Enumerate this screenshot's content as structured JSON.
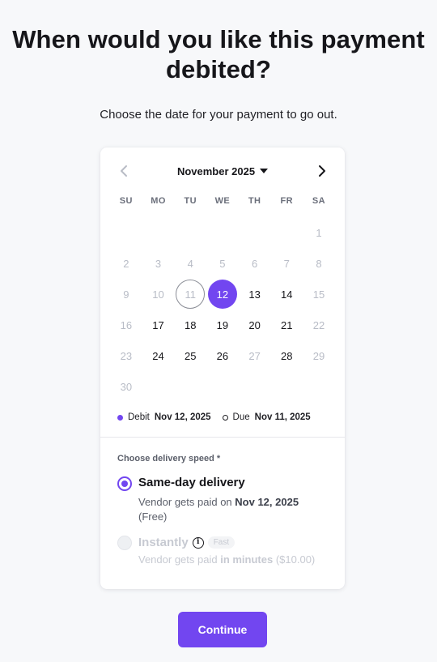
{
  "heading": "When would you like this payment debited?",
  "subtitle": "Choose the date for your payment to go out.",
  "calendar": {
    "month_label": "November 2025",
    "weekdays": [
      "SU",
      "MO",
      "TU",
      "WE",
      "TH",
      "FR",
      "SA"
    ],
    "leading_blank_days": 6,
    "days": [
      {
        "n": "1",
        "state": "disabled"
      },
      {
        "n": "2",
        "state": "disabled"
      },
      {
        "n": "3",
        "state": "disabled"
      },
      {
        "n": "4",
        "state": "disabled"
      },
      {
        "n": "5",
        "state": "disabled"
      },
      {
        "n": "6",
        "state": "disabled"
      },
      {
        "n": "7",
        "state": "disabled"
      },
      {
        "n": "8",
        "state": "disabled"
      },
      {
        "n": "9",
        "state": "disabled"
      },
      {
        "n": "10",
        "state": "disabled"
      },
      {
        "n": "11",
        "state": "due"
      },
      {
        "n": "12",
        "state": "selected"
      },
      {
        "n": "13",
        "state": "available"
      },
      {
        "n": "14",
        "state": "available"
      },
      {
        "n": "15",
        "state": "disabled"
      },
      {
        "n": "16",
        "state": "disabled"
      },
      {
        "n": "17",
        "state": "available"
      },
      {
        "n": "18",
        "state": "available"
      },
      {
        "n": "19",
        "state": "available"
      },
      {
        "n": "20",
        "state": "available"
      },
      {
        "n": "21",
        "state": "available"
      },
      {
        "n": "22",
        "state": "disabled"
      },
      {
        "n": "23",
        "state": "disabled"
      },
      {
        "n": "24",
        "state": "available"
      },
      {
        "n": "25",
        "state": "available"
      },
      {
        "n": "26",
        "state": "available"
      },
      {
        "n": "27",
        "state": "disabled"
      },
      {
        "n": "28",
        "state": "available"
      },
      {
        "n": "29",
        "state": "disabled"
      },
      {
        "n": "30",
        "state": "disabled"
      }
    ],
    "legend": {
      "debit_label": "Debit",
      "debit_date": "Nov 12, 2025",
      "due_label": "Due",
      "due_date": "Nov 11, 2025"
    }
  },
  "delivery": {
    "label": "Choose delivery speed *",
    "same_day": {
      "title": "Same-day delivery",
      "desc_prefix": "Vendor gets paid on",
      "desc_date": "Nov 12, 2025",
      "desc_suffix": "(Free)",
      "selected": true
    },
    "instant": {
      "title": "Instantly",
      "badge": "Fast",
      "info_glyph": "i",
      "desc_prefix": "Vendor gets paid",
      "desc_bold": "in minutes",
      "desc_suffix": "($10.00)",
      "selected": false,
      "disabled": true
    }
  },
  "continue_label": "Continue",
  "colors": {
    "accent": "#7246f0",
    "background": "#f7f8fa",
    "disabled_text": "#b8bcc6"
  },
  "icons": {
    "prev": "chevron-left-icon",
    "next": "chevron-right-icon",
    "month_dropdown": "caret-down-icon",
    "info": "info-icon"
  }
}
